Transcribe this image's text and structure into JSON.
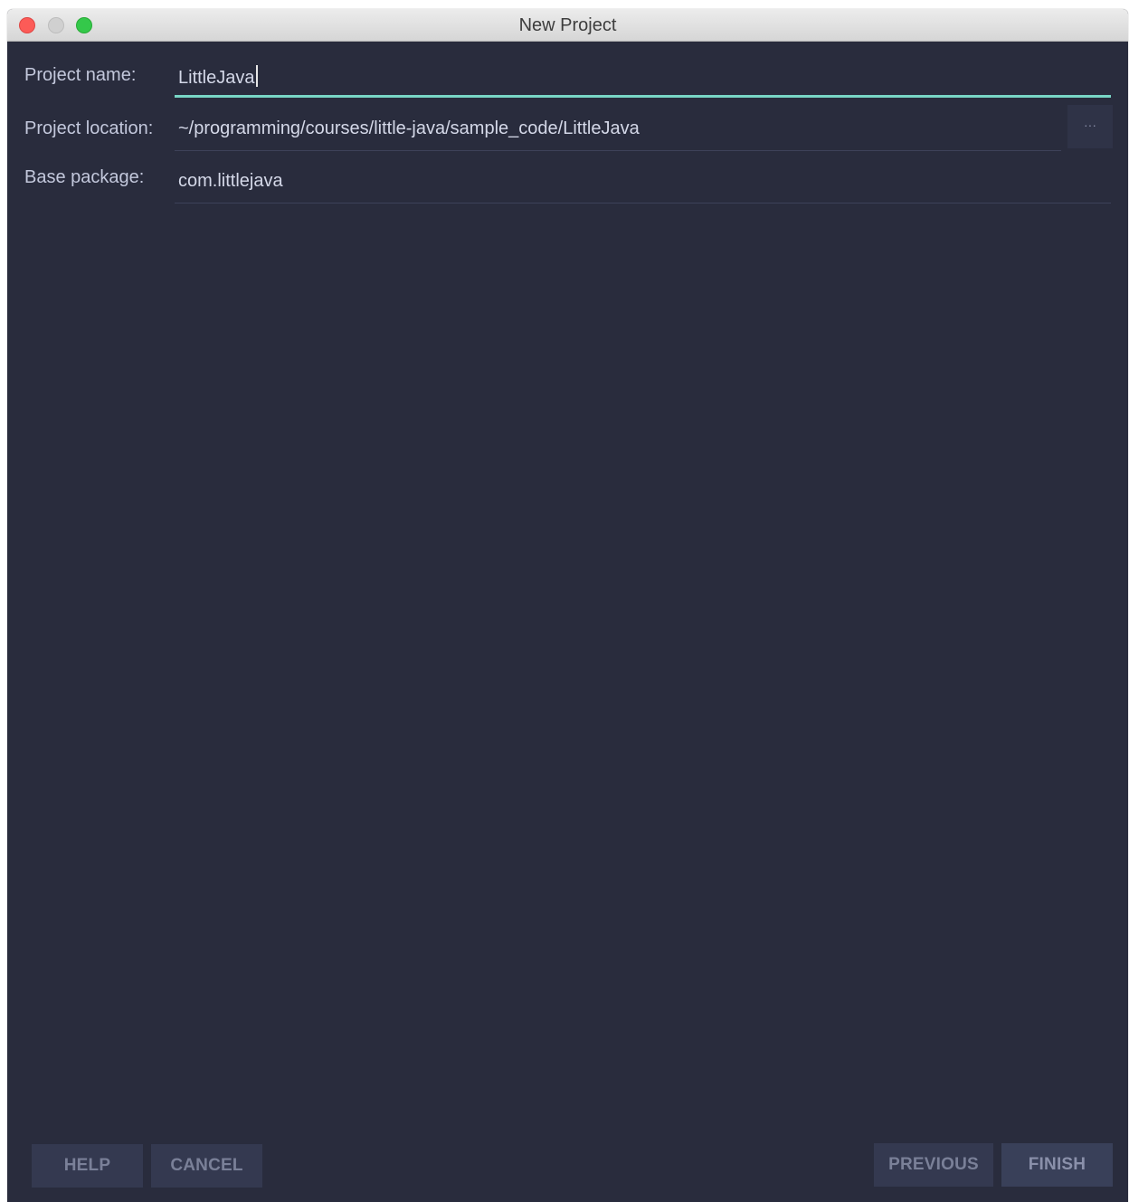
{
  "window": {
    "title": "New Project"
  },
  "form": {
    "project_name": {
      "label": "Project name:",
      "value": "LittleJava"
    },
    "project_location": {
      "label": "Project location:",
      "value": "~/programming/courses/little-java/sample_code/LittleJava",
      "browse_label": "···"
    },
    "base_package": {
      "label": "Base package:",
      "value": "com.littlejava"
    }
  },
  "buttons": {
    "help": "HELP",
    "cancel": "CANCEL",
    "previous": "PREVIOUS",
    "finish": "FINISH"
  },
  "colors": {
    "background": "#292c3d",
    "accent": "#78d6c6",
    "button_bg": "#343950"
  }
}
